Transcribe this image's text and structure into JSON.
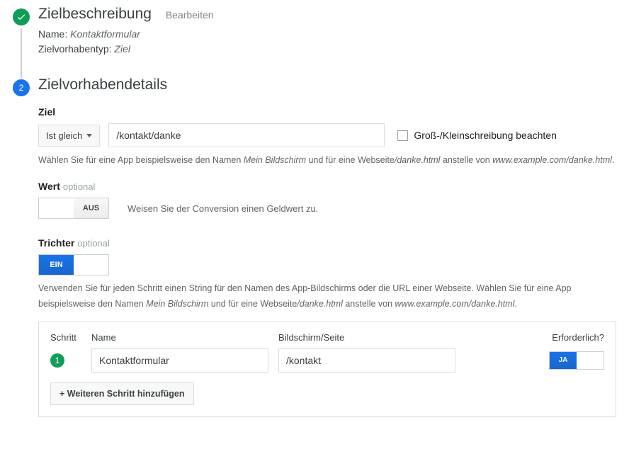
{
  "step1": {
    "title": "Zielbeschreibung",
    "edit": "Bearbeiten",
    "name_label": "Name:",
    "name_value": "Kontaktformular",
    "type_label": "Zielvorhabentyp:",
    "type_value": "Ziel"
  },
  "step2": {
    "number": "2",
    "title": "Zielvorhabendetails",
    "goal": {
      "label": "Ziel",
      "match_type": "Ist gleich",
      "url_value": "/kontakt/danke",
      "case_label": "Groß-/Kleinschreibung beachten",
      "help_a": "Wählen Sie für eine App beispielsweise den Namen ",
      "help_em1": "Mein Bildschirm",
      "help_b": " und für eine Webseite",
      "help_em2": "/danke.html",
      "help_c": " anstelle von ",
      "help_em3": "www.example.com/danke.html",
      "help_d": "."
    },
    "value": {
      "label": "Wert",
      "optional": "optional",
      "toggle_off": "AUS",
      "desc": "Weisen Sie der Conversion einen Geldwert zu."
    },
    "funnel": {
      "label": "Trichter",
      "optional": "optional",
      "toggle_on": "EIN",
      "help_a": "Verwenden Sie für jeden Schritt einen String für den Namen des App-Bildschirms oder die URL einer Webseite. Wählen Sie für eine App beispielsweise den Namen ",
      "help_em1": "Mein Bildschirm",
      "help_b": " und für eine Webseite",
      "help_em2": "/danke.html",
      "help_c": " anstelle von ",
      "help_em3": "www.example.com/danke.html",
      "help_d": ".",
      "col_step": "Schritt",
      "col_name": "Name",
      "col_screen": "Bildschirm/Seite",
      "col_req": "Erforderlich?",
      "row1_num": "1",
      "row1_name": "Kontaktformular",
      "row1_screen": "/kontakt",
      "row1_req": "JA",
      "add_button": "+ Weiteren Schritt hinzufügen"
    }
  }
}
